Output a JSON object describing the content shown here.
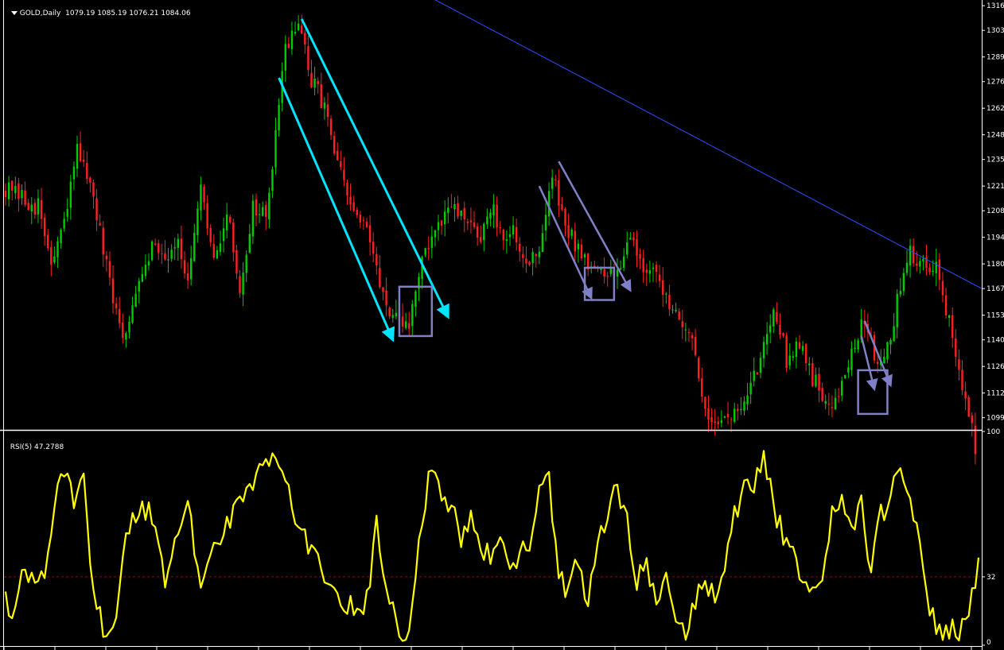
{
  "header": {
    "symbol": "GOLD,Daily",
    "ohlc": "1079.19 1085.19 1076.21 1084.06",
    "dropdown_icon": "triangle-down-icon"
  },
  "rsi_header": {
    "label": "RSI(5) 47.2788"
  },
  "colors": {
    "background": "#000000",
    "axis": "#ffffff",
    "bull": "#00cc00",
    "bear": "#ff2020",
    "trendline": "#2f4fff",
    "channel": "#00e5ff",
    "secondary_channel": "#8080c8",
    "rsi": "#ffff00",
    "rsi_level": "#a00000"
  },
  "chart_data": [
    {
      "type": "candlestick",
      "title": "GOLD,Daily",
      "ylim": [
        1093,
        1319
      ],
      "y_ticks": [
        1316,
        1303,
        1289,
        1276,
        1262,
        1248,
        1235,
        1221,
        1208,
        1194,
        1180,
        1167,
        1153,
        1140,
        1126,
        1112,
        1099
      ],
      "close_path": [
        [
          0,
          1220
        ],
        [
          5,
          1214
        ],
        [
          10,
          1210
        ],
        [
          14,
          1180
        ],
        [
          18,
          1200
        ],
        [
          22,
          1240
        ],
        [
          24,
          1236
        ],
        [
          28,
          1204
        ],
        [
          33,
          1160
        ],
        [
          37,
          1140
        ],
        [
          41,
          1175
        ],
        [
          45,
          1190
        ],
        [
          50,
          1185
        ],
        [
          53,
          1195
        ],
        [
          56,
          1168
        ],
        [
          60,
          1218
        ],
        [
          64,
          1180
        ],
        [
          68,
          1208
        ],
        [
          72,
          1166
        ],
        [
          76,
          1210
        ],
        [
          80,
          1204
        ],
        [
          84,
          1260
        ],
        [
          86,
          1296
        ],
        [
          90,
          1306
        ],
        [
          94,
          1276
        ],
        [
          98,
          1264
        ],
        [
          101,
          1238
        ],
        [
          106,
          1210
        ],
        [
          110,
          1200
        ],
        [
          114,
          1180
        ],
        [
          118,
          1150
        ],
        [
          124,
          1148
        ],
        [
          128,
          1184
        ],
        [
          133,
          1198
        ],
        [
          137,
          1210
        ],
        [
          142,
          1200
        ],
        [
          146,
          1196
        ],
        [
          150,
          1208
        ],
        [
          153,
          1188
        ],
        [
          156,
          1200
        ],
        [
          160,
          1180
        ],
        [
          164,
          1188
        ],
        [
          168,
          1226
        ],
        [
          172,
          1200
        ],
        [
          176,
          1188
        ],
        [
          180,
          1180
        ],
        [
          184,
          1172
        ],
        [
          188,
          1178
        ],
        [
          192,
          1196
        ],
        [
          195,
          1182
        ],
        [
          198,
          1176
        ],
        [
          202,
          1166
        ],
        [
          206,
          1156
        ],
        [
          210,
          1144
        ],
        [
          213,
          1120
        ],
        [
          216,
          1100
        ],
        [
          220,
          1098
        ],
        [
          224,
          1100
        ],
        [
          228,
          1110
        ],
        [
          232,
          1130
        ],
        [
          236,
          1160
        ],
        [
          240,
          1130
        ],
        [
          244,
          1140
        ],
        [
          248,
          1120
        ],
        [
          252,
          1108
        ],
        [
          256,
          1110
        ],
        [
          260,
          1135
        ],
        [
          264,
          1150
        ],
        [
          268,
          1128
        ],
        [
          272,
          1140
        ],
        [
          275,
          1170
        ],
        [
          278,
          1186
        ],
        [
          282,
          1180
        ],
        [
          286,
          1180
        ],
        [
          290,
          1150
        ],
        [
          293,
          1120
        ],
        [
          296,
          1100
        ],
        [
          298,
          1084
        ]
      ],
      "channels": [
        {
          "color": "cyan",
          "lines": [
            [
              [
                84,
                1278
              ],
              [
                119,
                1140
              ]
            ],
            [
              [
                91,
                1309
              ],
              [
                136,
                1152
              ]
            ]
          ]
        },
        {
          "color": "slate",
          "lines": [
            [
              [
                164,
                1221
              ],
              [
                180,
                1162
              ]
            ],
            [
              [
                170,
                1234
              ],
              [
                192,
                1166
              ]
            ]
          ]
        },
        {
          "color": "slate",
          "lines": [
            [
              [
                263,
                1142
              ],
              [
                267,
                1114
              ]
            ],
            [
              [
                264,
                1150
              ],
              [
                272,
                1116
              ]
            ]
          ]
        }
      ],
      "resistance_line": [
        [
          131,
          1320
        ],
        [
          300,
          1167
        ]
      ],
      "boxes": [
        {
          "x": [
            121,
            131
          ],
          "y": [
            1142,
            1168
          ]
        },
        {
          "x": [
            178,
            187
          ],
          "y": [
            1161,
            1178
          ]
        },
        {
          "x": [
            262,
            271
          ],
          "y": [
            1101,
            1124
          ]
        }
      ]
    },
    {
      "type": "line",
      "title": "RSI(5) 47.2788",
      "ylim": [
        0,
        100
      ],
      "y_ticks": [
        100,
        32,
        0
      ],
      "level": 32,
      "series": [
        {
          "values": [
            [
              0,
              22
            ],
            [
              3,
              15
            ],
            [
              6,
              40
            ],
            [
              9,
              25
            ],
            [
              12,
              35
            ],
            [
              15,
              65
            ],
            [
              18,
              80
            ],
            [
              21,
              70
            ],
            [
              24,
              80
            ],
            [
              27,
              25
            ],
            [
              30,
              8
            ],
            [
              34,
              10
            ],
            [
              37,
              50
            ],
            [
              41,
              65
            ],
            [
              45,
              62
            ],
            [
              49,
              30
            ],
            [
              53,
              55
            ],
            [
              56,
              66
            ],
            [
              60,
              25
            ],
            [
              63,
              48
            ],
            [
              66,
              45
            ],
            [
              70,
              66
            ],
            [
              74,
              70
            ],
            [
              78,
              82
            ],
            [
              82,
              88
            ],
            [
              86,
              78
            ],
            [
              90,
              55
            ],
            [
              94,
              42
            ],
            [
              98,
              35
            ],
            [
              101,
              25
            ],
            [
              104,
              20
            ],
            [
              108,
              15
            ],
            [
              111,
              20
            ],
            [
              114,
              55
            ],
            [
              117,
              30
            ],
            [
              120,
              8
            ],
            [
              124,
              5
            ],
            [
              127,
              52
            ],
            [
              131,
              85
            ],
            [
              134,
              72
            ],
            [
              137,
              65
            ],
            [
              140,
              50
            ],
            [
              143,
              60
            ],
            [
              146,
              48
            ],
            [
              149,
              40
            ],
            [
              152,
              55
            ],
            [
              155,
              35
            ],
            [
              158,
              40
            ],
            [
              161,
              50
            ],
            [
              164,
              70
            ],
            [
              167,
              80
            ],
            [
              170,
              30
            ],
            [
              173,
              25
            ],
            [
              176,
              40
            ],
            [
              179,
              20
            ],
            [
              182,
              52
            ],
            [
              185,
              60
            ],
            [
              188,
              75
            ],
            [
              191,
              60
            ],
            [
              194,
              30
            ],
            [
              197,
              35
            ],
            [
              200,
              25
            ],
            [
              203,
              28
            ],
            [
              206,
              10
            ],
            [
              209,
              5
            ],
            [
              212,
              20
            ],
            [
              215,
              30
            ],
            [
              218,
              20
            ],
            [
              221,
              40
            ],
            [
              224,
              60
            ],
            [
              227,
              75
            ],
            [
              230,
              72
            ],
            [
              233,
              90
            ],
            [
              236,
              65
            ],
            [
              239,
              50
            ],
            [
              242,
              45
            ],
            [
              245,
              25
            ],
            [
              248,
              32
            ],
            [
              251,
              25
            ],
            [
              254,
              60
            ],
            [
              257,
              70
            ],
            [
              260,
              55
            ],
            [
              263,
              65
            ],
            [
              266,
              35
            ],
            [
              269,
              60
            ],
            [
              272,
              72
            ],
            [
              275,
              85
            ],
            [
              278,
              70
            ],
            [
              281,
              45
            ],
            [
              284,
              15
            ],
            [
              287,
              5
            ],
            [
              290,
              8
            ],
            [
              293,
              8
            ],
            [
              296,
              15
            ],
            [
              299,
              35
            ]
          ]
        }
      ]
    }
  ]
}
